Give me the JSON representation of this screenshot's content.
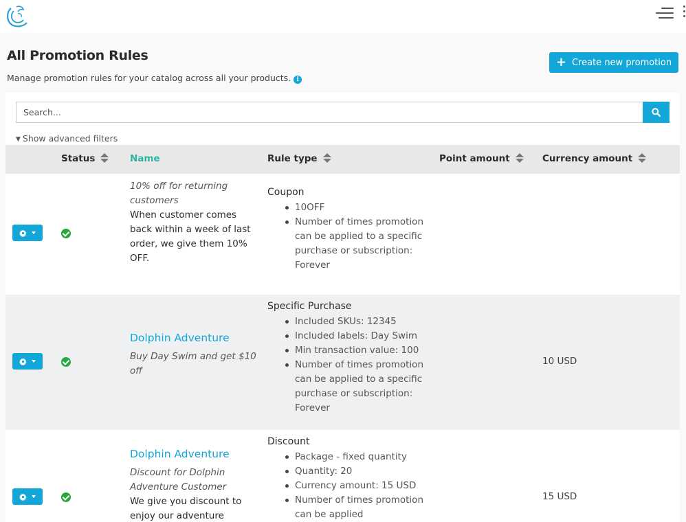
{
  "header": {
    "logo": "dolphin-logo",
    "menu_icon": "hamburger-icon",
    "more_icon": "vertical-dots-icon"
  },
  "page": {
    "title": "All Promotion Rules",
    "subtitle": "Manage promotion rules for your catalog across all your products.",
    "info_icon": "i",
    "create_button": "Create new promotion",
    "create_icon": "+"
  },
  "search": {
    "placeholder": "Search...",
    "value": "",
    "advanced_filters": "Show advanced filters"
  },
  "table": {
    "columns": [
      "Status",
      "Name",
      "Rule type",
      "Point amount",
      "Currency amount"
    ],
    "rows": [
      {
        "status": "active",
        "title": "",
        "italic": "10% off for returning customers",
        "description": "When customer comes back within a week of last order, we give them 10% OFF.",
        "rule_type": "Coupon",
        "rule_details": [
          "10OFF",
          "Number of times promotion can be applied to a specific purchase or subscription: Forever"
        ],
        "point_amount": "",
        "currency_amount": ""
      },
      {
        "status": "active",
        "title": "Dolphin Adventure",
        "italic": "Buy Day Swim and get $10 off",
        "description": "",
        "rule_type": "Specific Purchase",
        "rule_details": [
          "Included SKUs: 12345",
          "Included labels: Day Swim",
          "Min transaction value: 100",
          "Number of times promotion can be applied to a specific purchase or subscription: Forever"
        ],
        "point_amount": "",
        "currency_amount": "10 USD"
      },
      {
        "status": "active",
        "title": "Dolphin Adventure",
        "italic": "Discount for Dolphin Adventure Customer",
        "description": "We give you discount to enjoy our adventure",
        "rule_type": "Discount",
        "rule_details": [
          "Package - fixed quantity",
          "Quantity: 20",
          "Currency amount: 15 USD",
          "Number of times promotion can be applied"
        ],
        "point_amount": "",
        "currency_amount": "15 USD"
      }
    ]
  },
  "colors": {
    "accent": "#13a6d8",
    "name_header": "#2db5a0",
    "status_active": "#27a844"
  }
}
